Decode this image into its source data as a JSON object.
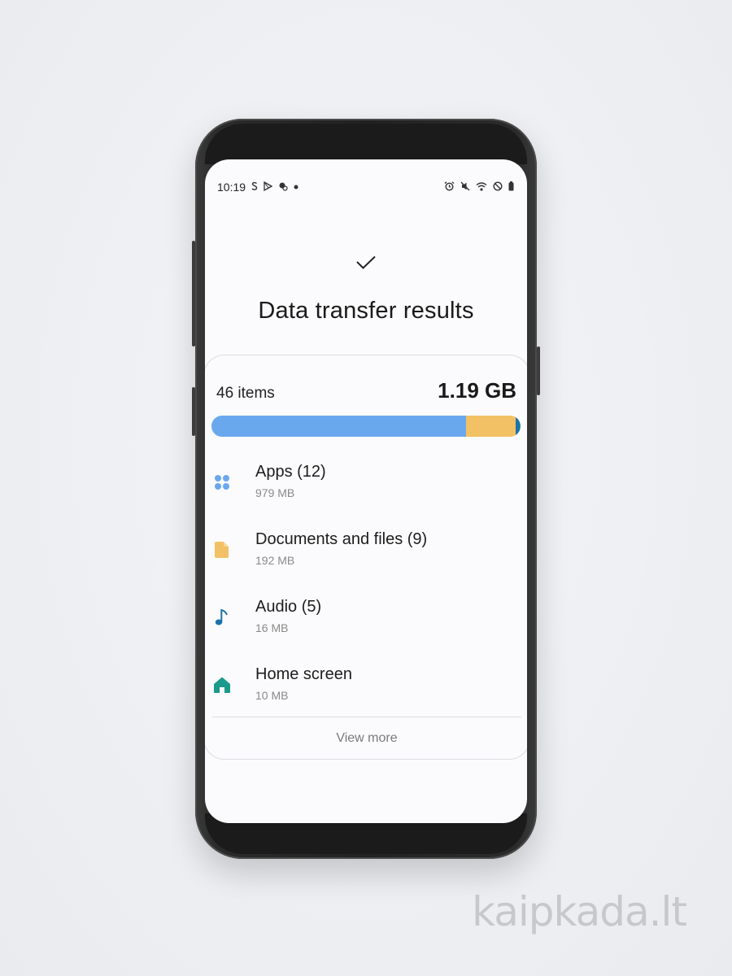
{
  "status_bar": {
    "time": "10:19",
    "left_icons": [
      "s-icon",
      "play-store-icon",
      "weather-icon",
      "dot-icon"
    ],
    "right_icons": [
      "alarm-icon",
      "mute-icon",
      "wifi-icon",
      "dnd-icon",
      "battery-icon"
    ]
  },
  "header": {
    "title": "Data transfer results"
  },
  "summary": {
    "count": "46 items",
    "size": "1.19 GB"
  },
  "storage_bar": {
    "segments": [
      {
        "name": "Apps",
        "fraction": 0.823,
        "color": "#6aa8ee"
      },
      {
        "name": "Documents and files",
        "fraction": 0.161,
        "color": "#f2c165"
      },
      {
        "name": "Audio",
        "fraction": 0.013,
        "color": "#1c73a6"
      },
      {
        "name": "Home screen",
        "fraction": 0.003,
        "color": "#1a9a8a"
      }
    ]
  },
  "items": [
    {
      "label": "Apps (12)",
      "size": "979 MB",
      "icon": "apps-grid-icon",
      "color": "#6aa8ee"
    },
    {
      "label": "Documents and files (9)",
      "size": "192 MB",
      "icon": "document-icon",
      "color": "#f2c165"
    },
    {
      "label": "Audio (5)",
      "size": "16 MB",
      "icon": "music-note-icon",
      "color": "#1c73a6"
    },
    {
      "label": "Home screen",
      "size": "10 MB",
      "icon": "home-icon",
      "color": "#1a9a8a"
    }
  ],
  "footer": {
    "view_more": "View more"
  },
  "watermark": "kaipkada.lt"
}
